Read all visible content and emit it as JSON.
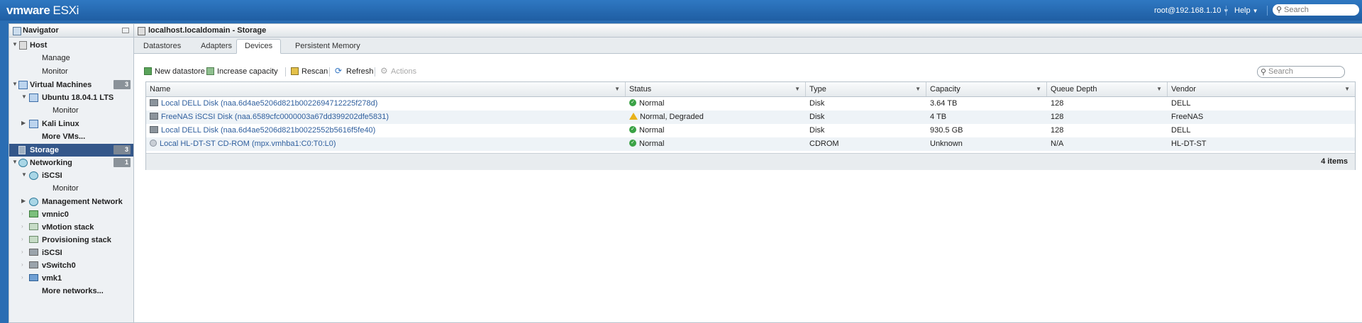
{
  "topbar": {
    "brand_vm": "vmware",
    "brand_product": "ESXi",
    "user": "root@192.168.1.10",
    "help": "Help",
    "search_placeholder": "Search"
  },
  "navigator": {
    "title": "Navigator",
    "items": [
      {
        "label": "Host"
      },
      {
        "label": "Manage"
      },
      {
        "label": "Monitor"
      },
      {
        "label": "Virtual Machines",
        "badge": "3"
      },
      {
        "label": "Ubuntu 18.04.1 LTS"
      },
      {
        "label": "Monitor"
      },
      {
        "label": "Kali Linux"
      },
      {
        "label": "More VMs..."
      },
      {
        "label": "Storage",
        "badge": "3"
      },
      {
        "label": "Networking",
        "badge": "1"
      },
      {
        "label": "iSCSI"
      },
      {
        "label": "Monitor"
      },
      {
        "label": "Management Network"
      },
      {
        "label": "vmnic0"
      },
      {
        "label": "vMotion stack"
      },
      {
        "label": "Provisioning stack"
      },
      {
        "label": "iSCSI"
      },
      {
        "label": "vSwitch0"
      },
      {
        "label": "vmk1"
      },
      {
        "label": "More networks..."
      }
    ]
  },
  "main": {
    "title": "localhost.localdomain - Storage",
    "tabs": [
      "Datastores",
      "Adapters",
      "Devices",
      "Persistent Memory"
    ],
    "active_tab": "Devices",
    "toolbar": {
      "new_datastore": "New datastore",
      "increase_capacity": "Increase capacity",
      "rescan": "Rescan",
      "refresh": "Refresh",
      "actions": "Actions"
    },
    "search_placeholder": "Search",
    "columns": [
      "Name",
      "Status",
      "Type",
      "Capacity",
      "Queue Depth",
      "Vendor"
    ],
    "rows": [
      {
        "name": "Local DELL Disk (naa.6d4ae5206d821b0022694712225f278d)",
        "status": "Normal",
        "status_kind": "ok",
        "type": "Disk",
        "capacity": "3.64 TB",
        "queue": "128",
        "vendor": "DELL",
        "icon": "disk-icon"
      },
      {
        "name": "FreeNAS iSCSI Disk (naa.6589cfc0000003a67dd399202dfe5831)",
        "status": "Normal, Degraded",
        "status_kind": "warn",
        "type": "Disk",
        "capacity": "4 TB",
        "queue": "128",
        "vendor": "FreeNAS",
        "icon": "disk-icon"
      },
      {
        "name": "Local DELL Disk (naa.6d4ae5206d821b0022552b5616f5fe40)",
        "status": "Normal",
        "status_kind": "ok",
        "type": "Disk",
        "capacity": "930.5 GB",
        "queue": "128",
        "vendor": "DELL",
        "icon": "disk-icon"
      },
      {
        "name": "Local HL-DT-ST CD-ROM (mpx.vmhba1:C0:T0:L0)",
        "status": "Normal",
        "status_kind": "ok",
        "type": "CDROM",
        "capacity": "Unknown",
        "queue": "N/A",
        "vendor": "HL-DT-ST",
        "icon": "cdrom-icon"
      }
    ],
    "item_count": "4 items"
  }
}
